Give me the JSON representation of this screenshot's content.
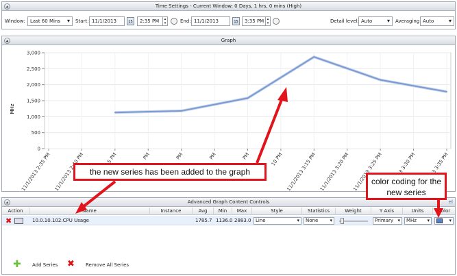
{
  "time_settings": {
    "title": "Time Settings - Current Window: 0 Days, 1 hrs, 0 mins (High)",
    "window_label": "Window:",
    "window_value": "Last 60 Mins",
    "start_label": "Start:",
    "start_date": "11/1/2013",
    "start_time": "2:35 PM",
    "end_label": "End:",
    "end_date": "11/1/2013",
    "end_time": "3:35 PM",
    "detail_label": "Detail level:",
    "detail_value": "Auto",
    "averaging_label": "Averaging:",
    "averaging_value": "Auto",
    "calendar_day": "15"
  },
  "graph": {
    "title": "Graph"
  },
  "chart_data": {
    "type": "line",
    "ylabel": "MHz",
    "ylim": [
      0,
      3000
    ],
    "yticks": [
      "0",
      "500",
      "1,000",
      "1,500",
      "2,000",
      "2,500",
      "3,000"
    ],
    "ytick_values": [
      0,
      500,
      1000,
      1500,
      2000,
      2500,
      3000
    ],
    "x_ticks": [
      "11/1/2013 2:35 PM",
      "11/1/2013 2:40 PM",
      "11/1/2013 2:45 PM",
      "11/1/2013 2:50 PM",
      "11/1/2013 2:55 PM",
      "11/1/2013 3:00 PM",
      "11/1/2013 3:05 PM",
      "11/1/2013 3:10 PM",
      "11/1/2013 3:15 PM",
      "11/1/2013 3:20 PM",
      "11/1/2013 3:25 PM",
      "11/1/2013 3:30 PM",
      "11/1/2013 3:35 PM"
    ],
    "x_visible_labels": [
      "11/1/2013 2:35 PM",
      "11/1/2013 2:40 PM",
      "5 PM",
      "PM",
      "PM",
      "PM",
      "PM",
      "10 PM",
      "11/1/2013 3:15 PM",
      "11/1/2013 3:20 PM",
      "11/1/2013 3:25 PM",
      "11/1/2013 3:30 PM",
      "11/1/2013 3:35 PM"
    ],
    "series": [
      {
        "x_index": [
          2,
          4,
          6,
          8,
          10,
          12
        ],
        "values": [
          1130,
          1180,
          1580,
          2870,
          2150,
          1780
        ],
        "color": "#7a9ad6"
      }
    ]
  },
  "advanced": {
    "title": "Advanced Graph Content Controls",
    "corner_text": "el",
    "columns": [
      "Action",
      "Name",
      "Instance",
      "Avg",
      "Min",
      "Max",
      "Style",
      "Statistics",
      "Weight",
      "Y Axis",
      "Units",
      "Color"
    ],
    "row": {
      "name": "10.0.10.102:CPU Usage",
      "instance": "",
      "avg": "1785.7",
      "min": "1136.0",
      "max": "2883.0",
      "style": "Line",
      "statistics": "None",
      "y_axis": "Primary",
      "units": "MHz",
      "color": "#4f83cc"
    },
    "add_series_label": "Add Series",
    "remove_all_label": "Remove All Series"
  },
  "annotations": {
    "series_added": "the new series has been added to the graph",
    "color_coding": "color coding for the new series",
    "accent": "#e0141a"
  }
}
